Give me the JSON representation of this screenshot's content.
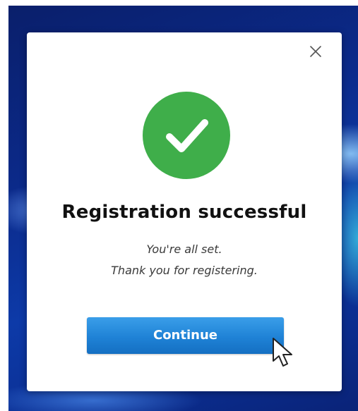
{
  "dialog": {
    "close_icon": "close-icon",
    "success_icon": "checkmark-icon",
    "success_color": "#3fae4a",
    "title": "Registration successful",
    "message_line1": "You're all set.",
    "message_line2": "Thank you for registering.",
    "continue_label": "Continue",
    "button_color": "#1f82d6"
  },
  "pointer": {
    "icon": "mouse-pointer-icon"
  }
}
